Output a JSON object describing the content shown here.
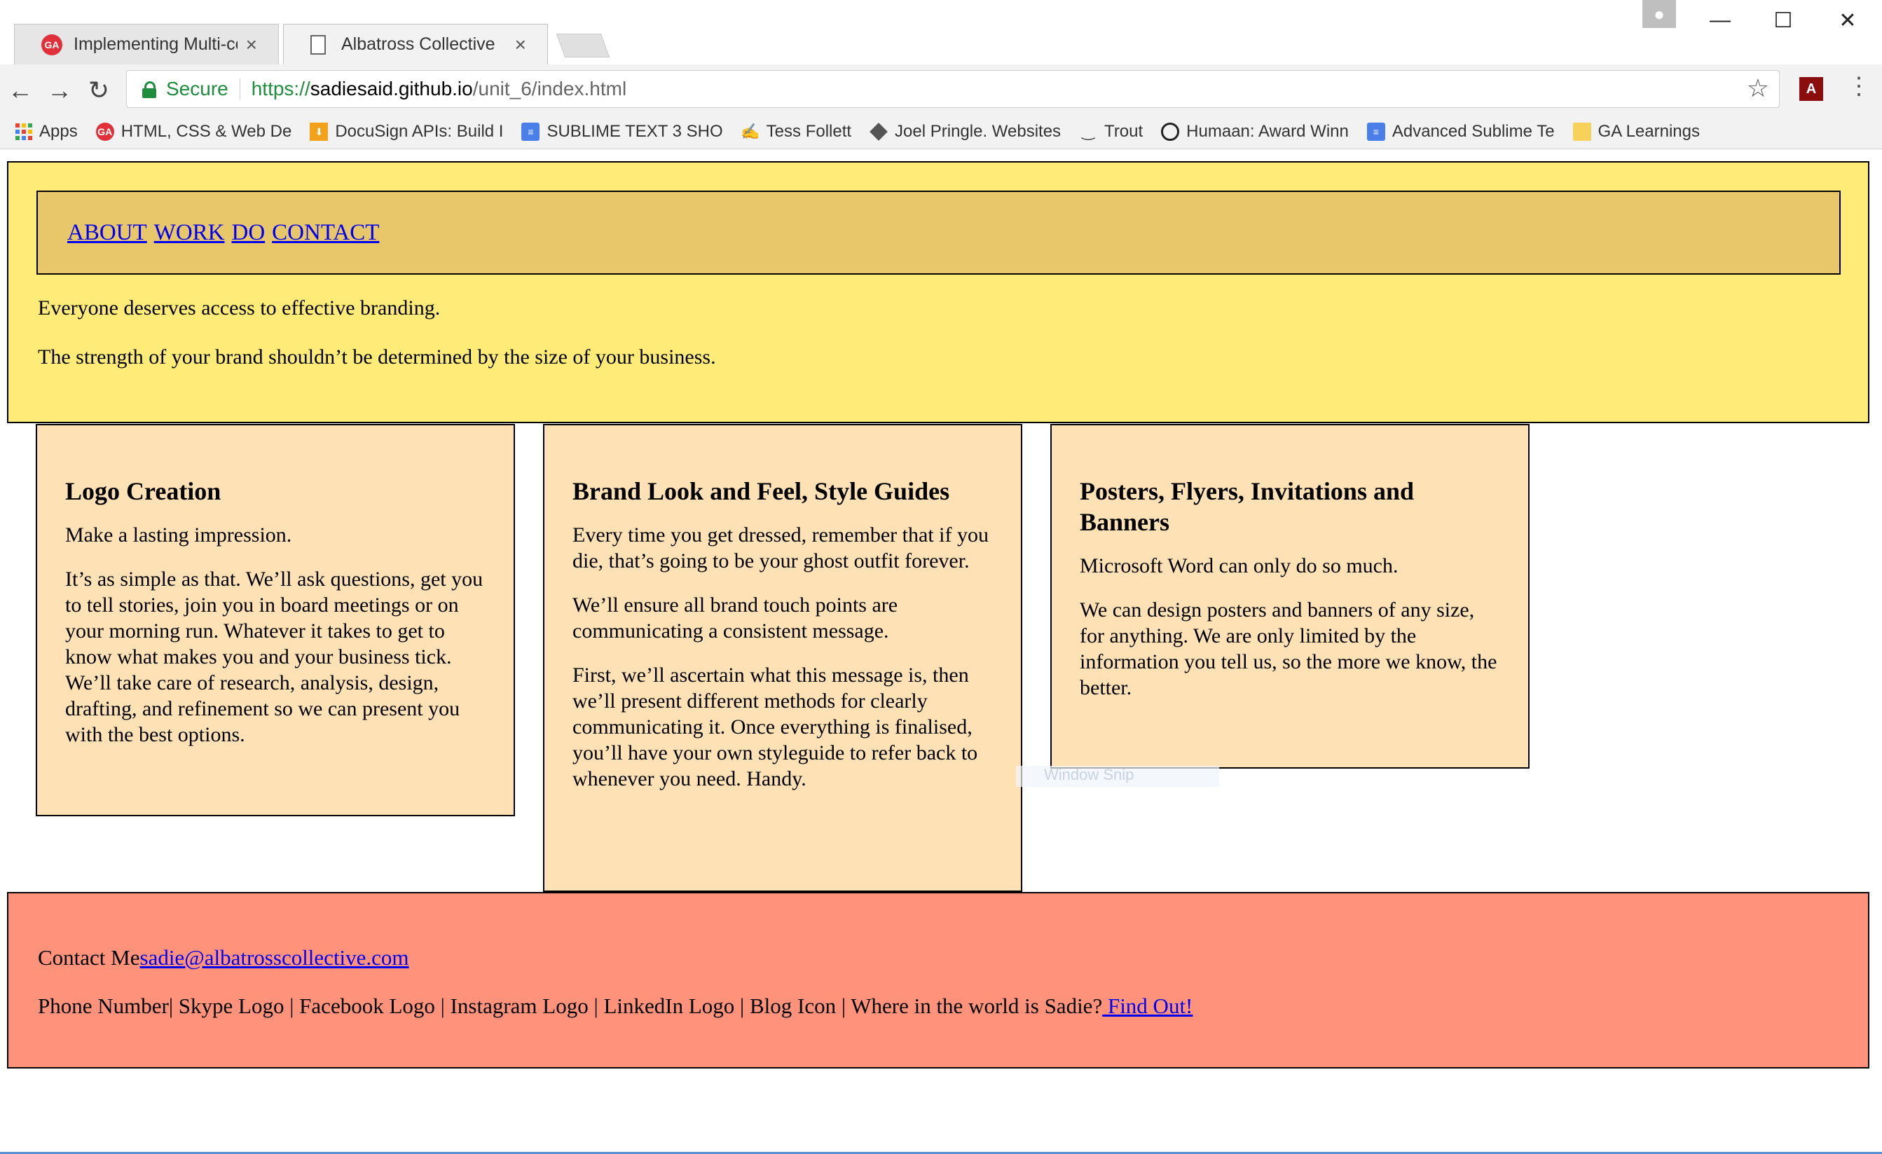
{
  "browser": {
    "tabs": [
      {
        "title": "Implementing Multi-colu",
        "favicon": "ga-logo-icon",
        "active": false
      },
      {
        "title": "Albatross Collective",
        "favicon": "page-icon",
        "active": true
      }
    ],
    "secure_label": "Secure",
    "url": {
      "scheme": "https://",
      "domain": "sadiesaid.github.io",
      "path": "/unit_6/index.html"
    },
    "bookmarks": [
      {
        "label": "Apps",
        "icon": "apps-icon"
      },
      {
        "label": "HTML, CSS & Web De",
        "icon": "ga-logo-icon"
      },
      {
        "label": "DocuSign APIs: Build I",
        "icon": "download-icon"
      },
      {
        "label": "SUBLIME TEXT 3 SHO",
        "icon": "doc-icon"
      },
      {
        "label": "Tess Follett",
        "icon": "signature-icon"
      },
      {
        "label": "Joel Pringle. Websites",
        "icon": "cube-icon"
      },
      {
        "label": "Trout",
        "icon": "smile-icon"
      },
      {
        "label": "Humaan: Award Winn",
        "icon": "circle-logo-icon"
      },
      {
        "label": "Advanced Sublime Te",
        "icon": "doc-icon"
      },
      {
        "label": "GA Learnings",
        "icon": "folder-icon"
      }
    ]
  },
  "page": {
    "nav": [
      "ABOUT",
      "WORK",
      "DO",
      "CONTACT"
    ],
    "hero": [
      "Everyone deserves access to effective branding.",
      "The strength of your brand shouldn’t be determined by the size of your business."
    ],
    "cards": [
      {
        "title": "Logo Creation",
        "paragraphs": [
          "Make a lasting impression.",
          "It’s as simple as that. We’ll ask questions, get you to tell stories, join you in board meetings or on your morning run. Whatever it takes to get to know what makes you and your business tick. We’ll take care of research, analysis, design, drafting, and refinement so we can present you with the best options."
        ]
      },
      {
        "title": "Brand Look and Feel, Style Guides",
        "paragraphs": [
          "Every time you get dressed, remember that if you die, that’s going to be your ghost outfit forever.",
          "We’ll ensure all brand touch points are communicating a consistent message.",
          "First, we’ll ascertain what this message is, then we’ll present different methods for clearly communicating it. Once everything is finalised, you’ll have your own styleguide to refer back to whenever you need. Handy."
        ]
      },
      {
        "title": "Posters, Flyers, Invitations and Banners",
        "paragraphs": [
          "Microsoft Word can only do so much.",
          "We can design posters and banners of any size, for anything. We are only limited by the information you tell us, so the more we know, the better."
        ]
      }
    ],
    "ghost_label": "Window Snip",
    "footer": {
      "contact_label": "Contact Me",
      "email": "sadie@albatrosscollective.com",
      "social_text": "Phone Number| Skype Logo | Facebook Logo | Instagram Logo | LinkedIn Logo | Blog Icon | Where in the world is Sadie?",
      "find_out": " Find Out!"
    }
  },
  "colors": {
    "header_bg": "#ffec78",
    "nav_bg": "#e8c76a",
    "card_bg": "#fee1b4",
    "footer_bg": "#ff927b",
    "link": "#0000ee"
  }
}
